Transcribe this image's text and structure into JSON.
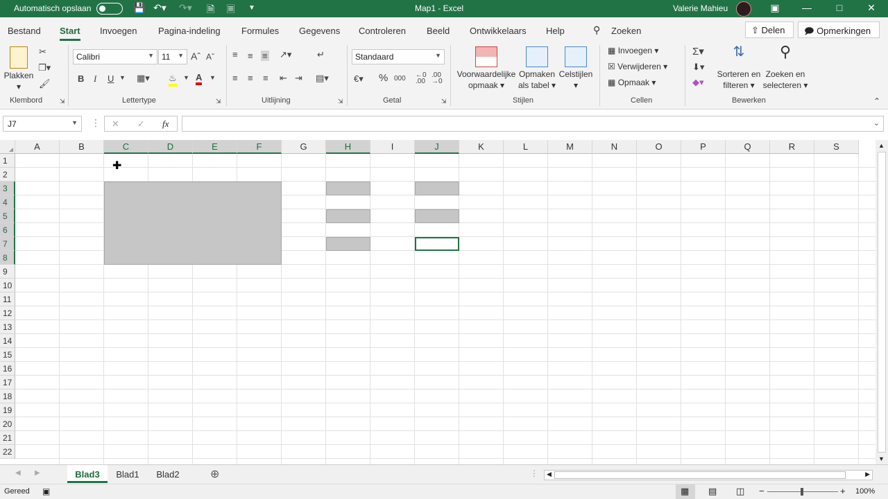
{
  "titlebar": {
    "autosave_label": "Automatisch opslaan",
    "document_title": "Map1 - Excel",
    "user_name": "Valerie Mahieu",
    "qa_icons": [
      "save-icon",
      "undo-icon",
      "redo-icon",
      "new-file-icon",
      "open-icon",
      "customize-icon"
    ]
  },
  "tabs": [
    "Bestand",
    "Start",
    "Invoegen",
    "Pagina-indeling",
    "Formules",
    "Gegevens",
    "Controleren",
    "Beeld",
    "Ontwikkelaars",
    "Help"
  ],
  "active_tab": "Start",
  "search_label": "Zoeken",
  "share_label": "Delen",
  "comments_label": "Opmerkingen",
  "ribbon": {
    "clipboard": {
      "paste_label": "Plakken",
      "group_label": "Klembord"
    },
    "font": {
      "font_name": "Calibri",
      "font_size": "11",
      "bold": "B",
      "italic": "I",
      "underline": "U",
      "group_label": "Lettertype"
    },
    "alignment": {
      "group_label": "Uitlijning"
    },
    "number": {
      "format": "Standaard",
      "percent": "%",
      "thousands": "000",
      "group_label": "Getal"
    },
    "styles": {
      "conditional_1": "Voorwaardelijke",
      "conditional_2": "opmaak",
      "table_1": "Opmaken",
      "table_2": "als tabel",
      "cell_styles": "Celstijlen",
      "group_label": "Stijlen"
    },
    "cells": {
      "insert": "Invoegen",
      "delete": "Verwijderen",
      "format": "Opmaak",
      "group_label": "Cellen"
    },
    "editing": {
      "sort_1": "Sorteren en",
      "sort_2": "filteren",
      "find_1": "Zoeken en",
      "find_2": "selecteren",
      "group_label": "Bewerken"
    }
  },
  "formula_bar": {
    "name_box": "J7",
    "fx": "fx",
    "formula": ""
  },
  "columns": [
    "A",
    "B",
    "C",
    "D",
    "E",
    "F",
    "G",
    "H",
    "I",
    "J",
    "K",
    "L",
    "M",
    "N",
    "O",
    "P",
    "Q",
    "R",
    "S"
  ],
  "selected_columns": [
    "C",
    "D",
    "E",
    "F",
    "H",
    "J"
  ],
  "rows": [
    "1",
    "2",
    "3",
    "4",
    "5",
    "6",
    "7",
    "8",
    "9",
    "10",
    "11",
    "12",
    "13",
    "14",
    "15",
    "16",
    "17",
    "18",
    "19",
    "20",
    "21",
    "22"
  ],
  "selected_rows": [
    "3",
    "4",
    "5",
    "6",
    "7",
    "8"
  ],
  "selection": {
    "ranges": [
      "C3:F8",
      "H3",
      "H5",
      "H7",
      "J3",
      "J5"
    ],
    "active_cell": "J7"
  },
  "sheets": [
    "Blad3",
    "Blad1",
    "Blad2"
  ],
  "active_sheet": "Blad3",
  "status": {
    "ready": "Gereed",
    "zoom": "100%"
  }
}
